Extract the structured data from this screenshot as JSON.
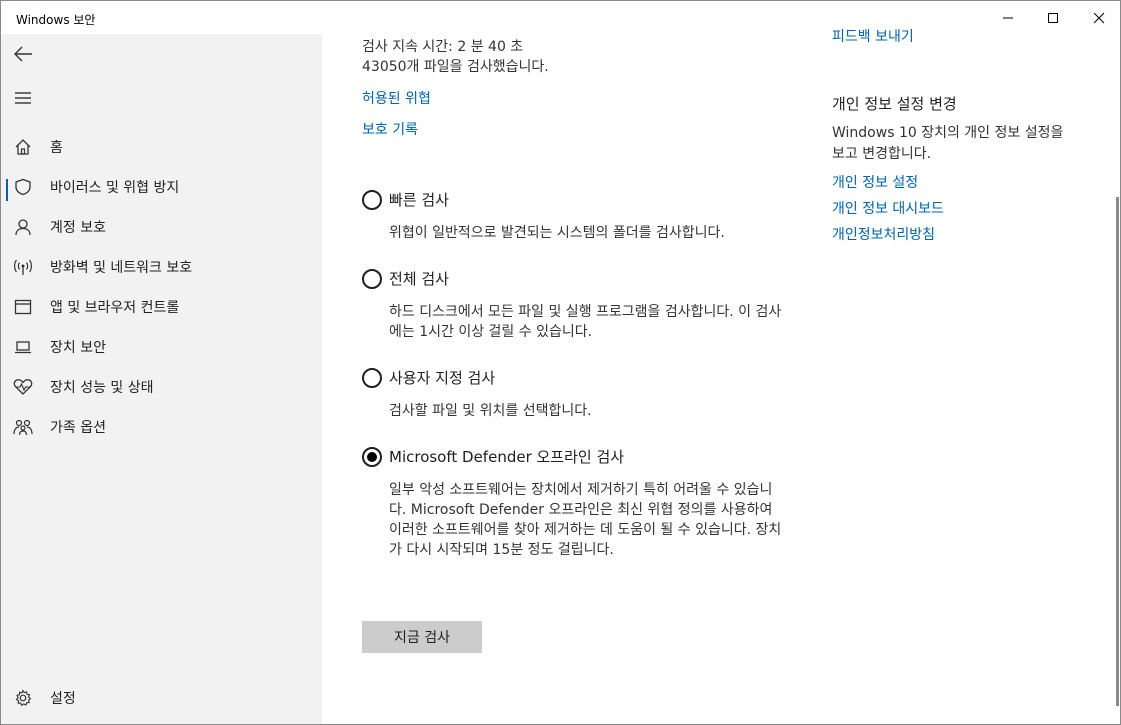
{
  "window": {
    "title": "Windows 보안"
  },
  "sidebar": {
    "items": [
      {
        "label": "홈",
        "icon": "home-icon"
      },
      {
        "label": "바이러스 및 위협 방지",
        "icon": "shield-icon",
        "active": true
      },
      {
        "label": "계정 보호",
        "icon": "person-icon"
      },
      {
        "label": "방화벽 및 네트워크 보호",
        "icon": "wireless-icon"
      },
      {
        "label": "앱 및 브라우저 컨트롤",
        "icon": "app-window-icon"
      },
      {
        "label": "장치 보안",
        "icon": "laptop-icon"
      },
      {
        "label": "장치 성능 및 상태",
        "icon": "heart-pulse-icon"
      },
      {
        "label": "가족 옵션",
        "icon": "family-icon"
      }
    ],
    "settings_label": "설정"
  },
  "main": {
    "scan_duration": "검사 지속 시간: 2 분 40 초",
    "files_scanned": "43050개 파일을 검사했습니다.",
    "allowed_threats_link": "허용된 위협",
    "protection_history_link": "보호 기록",
    "options": [
      {
        "label": "빠른 검사",
        "description": "위협이 일반적으로 발견되는 시스템의 폴더를 검사합니다.",
        "checked": false
      },
      {
        "label": "전체 검사",
        "description": "하드 디스크에서 모든 파일 및 실행 프로그램을 검사합니다. 이 검사에는 1시간 이상 걸릴 수 있습니다.",
        "checked": false
      },
      {
        "label": "사용자 지정 검사",
        "description": "검사할 파일 및 위치를 선택합니다.",
        "checked": false
      },
      {
        "label": "Microsoft Defender 오프라인 검사",
        "description": "일부 악성 소프트웨어는 장치에서 제거하기 특히 어려울 수 있습니다. Microsoft Defender 오프라인은 최신 위협 정의를 사용하여 이러한 소프트웨어를 찾아 제거하는 데 도움이 될 수 있습니다. 장치가 다시 시작되며 15분 정도 걸립니다.",
        "checked": true
      }
    ],
    "scan_now_button": "지금 검사"
  },
  "right": {
    "feedback_link": "피드백 보내기",
    "privacy_heading": "개인 정보 설정 변경",
    "privacy_desc": "Windows 10 장치의 개인 정보 설정을 보고 변경합니다.",
    "links": [
      "개인 정보 설정",
      "개인 정보 대시보드",
      "개인정보처리방침"
    ]
  },
  "colors": {
    "accent": "#0063b1",
    "sidebar_bg": "#f2f2f2",
    "button_bg": "#cccccc"
  }
}
